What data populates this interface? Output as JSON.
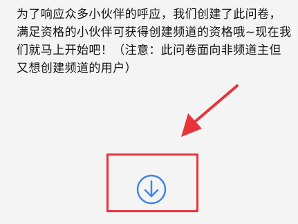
{
  "intro_text": "为了响应众多小伙伴的呼应，我们创建了此问卷，满足资格的小伙伴可获得创建频道的资格哦~现在我们就马上开始吧！（注意：此问卷面向非频道主但又想创建频道的用户）",
  "icons": {
    "download": "download-circle-icon"
  },
  "colors": {
    "highlight": "#e8333b",
    "icon": "#3f84e5",
    "text": "#111111",
    "background": "#f4f4f4"
  }
}
